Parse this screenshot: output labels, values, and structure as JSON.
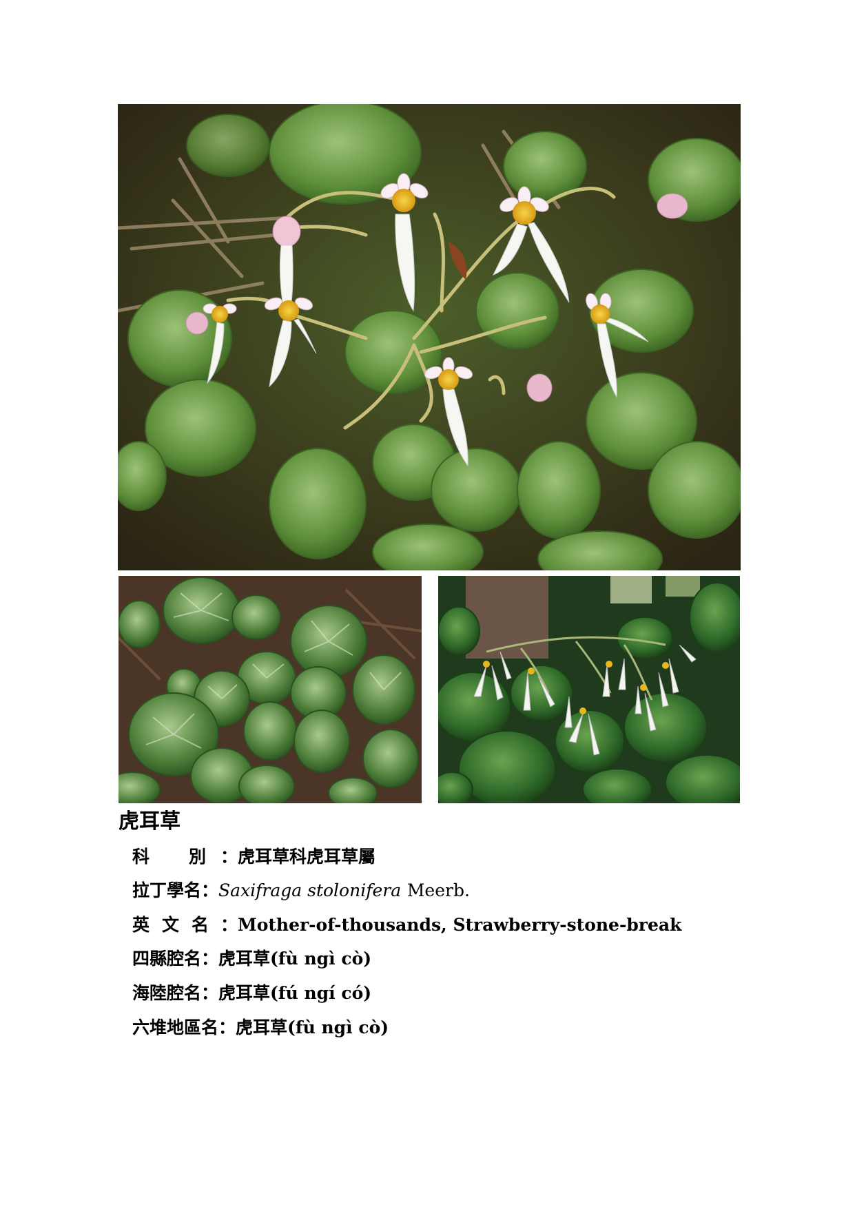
{
  "plant": {
    "title": "虎耳草",
    "family": {
      "label_a": "科",
      "label_b": "別",
      "sep": "：",
      "value": "虎耳草科虎耳草屬"
    },
    "latin": {
      "label": "拉丁學名",
      "sep": "：",
      "genus_species": "Saxifraga stolonifera",
      "author": "Meerb."
    },
    "english": {
      "label_chars": [
        "英",
        "文",
        "名"
      ],
      "sep": "：",
      "value": "Mother-of-thousands, Strawberry-stone-break"
    },
    "sixian": {
      "label": "四縣腔名",
      "sep": "：",
      "value_cjk": "虎耳草",
      "value_rom": "(fù ngì cò)"
    },
    "hailu": {
      "label": "海陸腔名",
      "sep": "：",
      "value_cjk": "虎耳草",
      "value_rom": "(fú ngí có)"
    },
    "liudui": {
      "label": "六堆地區名",
      "sep": "：",
      "value_cjk": "虎耳草",
      "value_rom": "(fù ngì cò)"
    }
  },
  "colors": {
    "foliage_dark": "#2f4a1c",
    "foliage_mid": "#5f8a3a",
    "foliage_light": "#8fb56a",
    "petal": "#f4f4f0",
    "center": "#e7b81e",
    "soil": "#3a2c17"
  }
}
